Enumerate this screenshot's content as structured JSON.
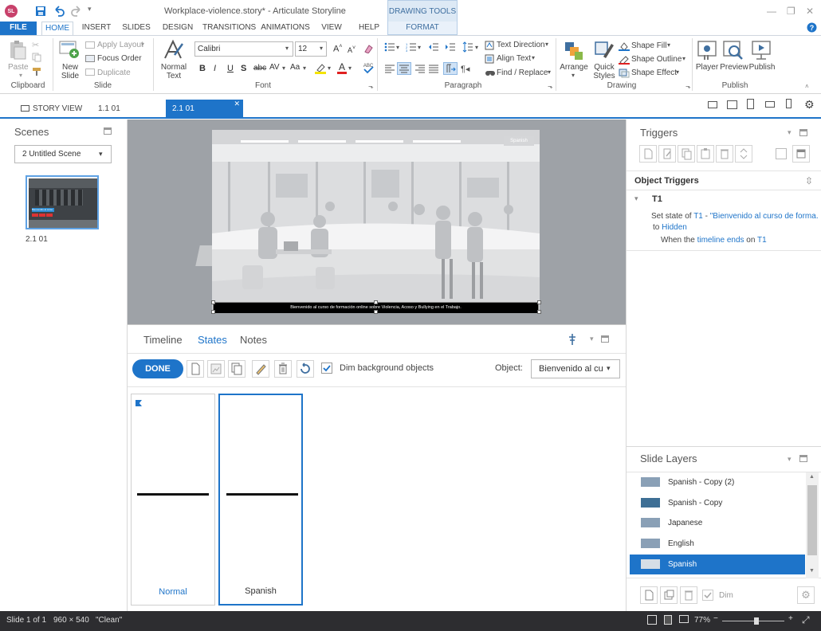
{
  "app": {
    "logo_text": "SL",
    "window_title": "Workplace-violence.story* - Articulate Storyline",
    "context_tab_group": "DRAWING TOOLS"
  },
  "ribbon_tabs": [
    "FILE",
    "HOME",
    "INSERT",
    "SLIDES",
    "DESIGN",
    "TRANSITIONS",
    "ANIMATIONS",
    "VIEW",
    "HELP",
    "FORMAT"
  ],
  "ribbon": {
    "clipboard": {
      "paste": "Paste",
      "label": "Clipboard"
    },
    "slide": {
      "new_slide": "New",
      "new_slide2": "Slide",
      "apply_layout": "Apply Layout",
      "focus_order": "Focus Order",
      "duplicate": "Duplicate",
      "label": "Slide"
    },
    "text": {
      "normal_text": "Normal",
      "normal_text2": "Text"
    },
    "font": {
      "family": "Calibri",
      "size": "12",
      "label": "Font"
    },
    "paragraph": {
      "text_direction": "Text Direction",
      "align_text": "Align Text",
      "find_replace": "Find / Replace",
      "label": "Paragraph"
    },
    "drawing": {
      "arrange": "Arrange",
      "quick_styles": "Quick",
      "quick_styles2": "Styles",
      "shape_fill": "Shape Fill",
      "shape_outline": "Shape Outline",
      "shape_effect": "Shape Effect",
      "label": "Drawing"
    },
    "publish": {
      "player": "Player",
      "preview": "Preview",
      "publish": "Publish",
      "label": "Publish"
    }
  },
  "doc_tabs": {
    "story_view": "STORY VIEW",
    "tab1": "1.1 01",
    "tab2": "2.1 01"
  },
  "scenes": {
    "title": "Scenes",
    "dropdown": "2 Untitled Scene",
    "thumb_label": "2.1 01",
    "thumb_banner": "Bienvenido al curso"
  },
  "slide": {
    "caption": "Bienvenido al curso de formación online sobre Violencia, Acoso y Bullying en el Trabajo.",
    "button_label": "Spanish"
  },
  "bottom_tabs": {
    "timeline": "Timeline",
    "states": "States",
    "notes": "Notes"
  },
  "states_toolbar": {
    "done": "DONE",
    "dim_background": "Dim background objects",
    "dim_checked": true,
    "object_label": "Object:",
    "object_value": "Bienvenido al cu"
  },
  "states": [
    {
      "label": "Normal",
      "color": "#1e74c9"
    },
    {
      "label": "Spanish",
      "color": "#333333"
    }
  ],
  "triggers": {
    "title": "Triggers",
    "object_triggers": "Object Triggers",
    "group": "T1",
    "action_prefix": "Set state of ",
    "action_object": "T1",
    "action_dash": " - ",
    "action_state": "\"Bienvenido al curso de forma...",
    "to_label": "to ",
    "to_value": "Hidden",
    "when_prefix": "When the ",
    "when_event": "timeline ends",
    "when_on": " on ",
    "when_object": "T1"
  },
  "layers": {
    "title": "Slide Layers",
    "items": [
      "Spanish - Copy (2)",
      "Spanish - Copy",
      "Japanese",
      "English",
      "Spanish"
    ],
    "selected_index": 4,
    "dim_label": "Dim"
  },
  "status": {
    "slide": "Slide 1 of 1",
    "size": "960 × 540",
    "state": "\"Clean\"",
    "zoom": "77%",
    "zoom_fraction": 0.55
  },
  "colors": {
    "accent": "#1e74c9",
    "statusbar": "#2d2d30",
    "logo": "#c8416b"
  }
}
